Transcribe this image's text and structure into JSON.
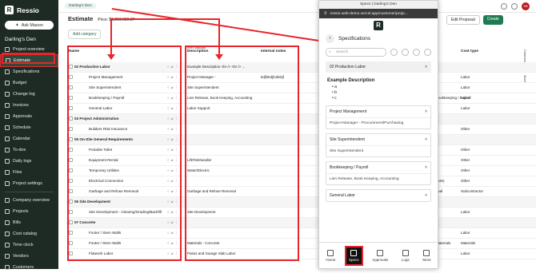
{
  "app": {
    "name": "Ressio",
    "ask_label": "Ask Mason",
    "project_name": "Darling's Den"
  },
  "sidebar": {
    "items": [
      "Project overview",
      "Estimate",
      "Specifications",
      "Budget",
      "Change log",
      "Invoices",
      "Approvals",
      "Schedule",
      "Calendar",
      "To-dos",
      "Daily logs",
      "Files",
      "Project settings"
    ],
    "items2": [
      "Company overview",
      "Projects",
      "Bills",
      "Cost catalog",
      "Time clock",
      "Vendors",
      "Customers"
    ]
  },
  "topbar": {
    "breadcrumb": "Darling's Den",
    "edit_proposal": "Edit Proposal",
    "create": "Create"
  },
  "estimate": {
    "title": "Estimate",
    "price_label": "Price: $1,219,636.37",
    "add_category": "Add category"
  },
  "table": {
    "group_header": "Item details",
    "headers": {
      "name": "Name",
      "description": "Description",
      "notes": "Internal notes",
      "cost_type": "Cost type"
    },
    "rows": [
      {
        "type": "section",
        "name": "02 Production Labor",
        "desc": "Example Description <br /> <br /> ...",
        "notes": "",
        "extra": "",
        "cost": ""
      },
      {
        "type": "item",
        "name": "Project Management",
        "desc": "Project Manager -",
        "notes": "kdjfskdjfoidskjf",
        "extra": "",
        "cost": "Labor"
      },
      {
        "type": "item",
        "name": "Site Superintendent",
        "desc": "Site Superintendent",
        "notes": "",
        "extra": "",
        "cost": "Labor"
      },
      {
        "type": "item",
        "name": "Bookkeeping / Payroll",
        "desc": "Lien Release, Book Keeping, Accounting",
        "notes": "",
        "extra": "Bookkeeping / Payroll",
        "cost": "Labor"
      },
      {
        "type": "item",
        "name": "General Labor",
        "desc": "Labor Support",
        "notes": "",
        "extra": "",
        "cost": "Labor"
      },
      {
        "type": "section",
        "name": "03 Project Administration",
        "desc": "",
        "notes": "",
        "extra": "",
        "cost": ""
      },
      {
        "type": "item",
        "name": "Builders Risk Insurance",
        "desc": "",
        "notes": "",
        "extra": "",
        "cost": "Other"
      },
      {
        "type": "section",
        "name": "05 On-Site General Requirements",
        "desc": "",
        "notes": "",
        "extra": "",
        "cost": ""
      },
      {
        "type": "item",
        "name": "Portable Toilet",
        "desc": "",
        "notes": "",
        "extra": "",
        "cost": "Other"
      },
      {
        "type": "item",
        "name": "Equipment Rental",
        "desc": "Lift/Telehandler",
        "notes": "",
        "extra": "",
        "cost": "Other"
      },
      {
        "type": "item",
        "name": "Temporary Utilities",
        "desc": "Water/Electric",
        "notes": "",
        "extra": "",
        "cost": "Other"
      },
      {
        "type": "item",
        "name": "Electrical Connection",
        "desc": "",
        "notes": "",
        "extra": "Pole)",
        "cost": "Other"
      },
      {
        "type": "item",
        "name": "Garbage and Refuse Removal",
        "desc": "Garbage and Refuse Removal",
        "notes": "",
        "extra": "oval",
        "cost": "Subcontractor"
      },
      {
        "type": "section",
        "name": "06 Site Development",
        "desc": "",
        "notes": "",
        "extra": "",
        "cost": ""
      },
      {
        "type": "item",
        "name": "Site Development - Clearing/Grading/Backfill",
        "desc": "Site Development",
        "notes": "",
        "extra": "",
        "cost": "Labor"
      },
      {
        "type": "section",
        "name": "07 Concrete",
        "desc": "",
        "notes": "",
        "extra": "",
        "cost": ""
      },
      {
        "type": "item",
        "name": "Footer / Stem Walls",
        "desc": "",
        "notes": "",
        "extra": "",
        "cost": "Labor"
      },
      {
        "type": "item",
        "name": "Footer / Stem Walls",
        "desc": "Materials - Concrete",
        "notes": "",
        "extra": "Materials",
        "cost": "Materials"
      },
      {
        "type": "item",
        "name": "Flatwork Labor",
        "desc": "Patios and Garage Slab Labor",
        "notes": "",
        "extra": "",
        "cost": "Labor"
      }
    ]
  },
  "phone": {
    "window_title": "Specs | Darling's Den",
    "url": "ressio-web-demo.vercel.app/customer/proje...",
    "heading": "Specifications",
    "search_placeholder": "Search",
    "section": "02 Production Labor",
    "example_title": "Example Description",
    "bullets": [
      "a",
      "b",
      "c"
    ],
    "cards": [
      {
        "title": "Project Management",
        "body": "Project Manager - Procurement/Purchasing"
      },
      {
        "title": "Site Superintendent",
        "body": "Site Superintendent"
      },
      {
        "title": "Bookkeeping / Payroll",
        "body": "Lien Release, Book Keeping, Accounting"
      },
      {
        "title": "General Labor",
        "body": ""
      }
    ],
    "tabs": [
      "Home",
      "Specs",
      "Approvals",
      "Logs",
      "More"
    ]
  },
  "side_tabs": {
    "columns": "Columns",
    "more": "More"
  }
}
